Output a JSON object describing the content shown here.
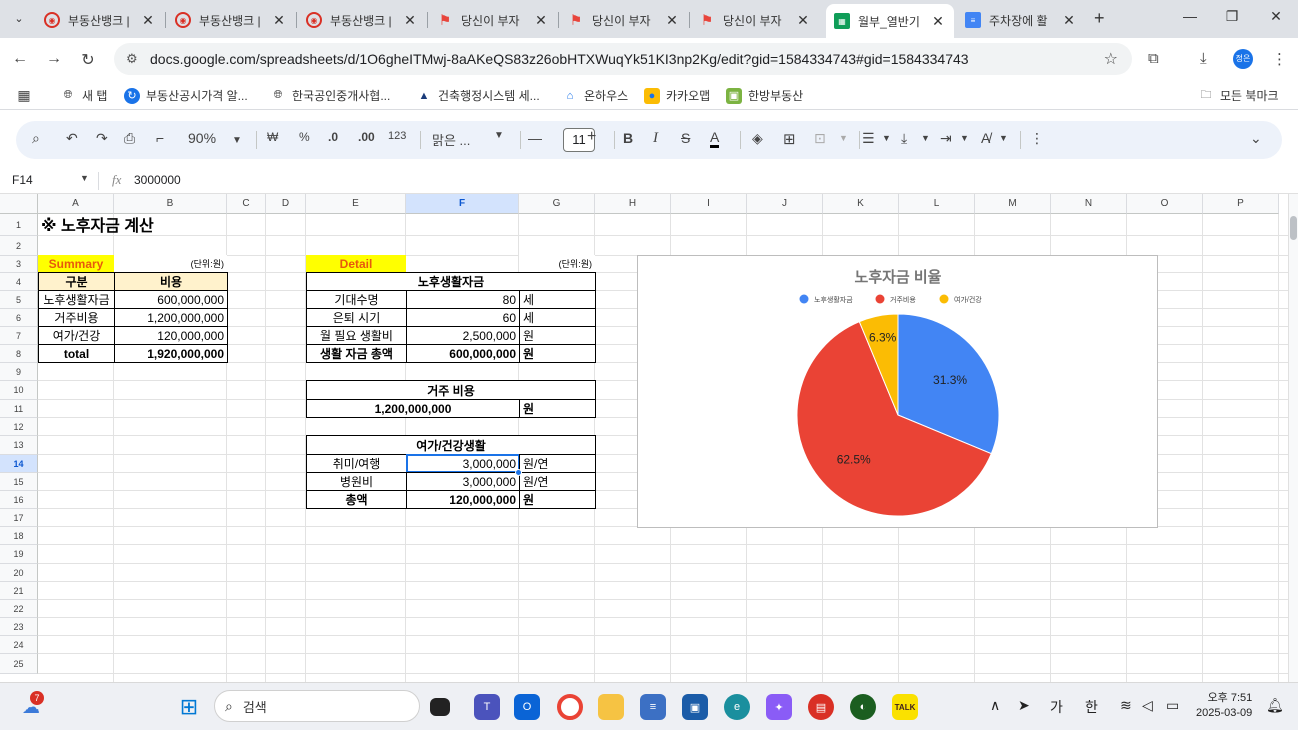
{
  "browser": {
    "tabs": [
      {
        "title": "부동산뱅크 |",
        "icon": "budongsanbank-icon",
        "color": "#d93025"
      },
      {
        "title": "부동산뱅크 |",
        "icon": "budongsanbank-icon",
        "color": "#d93025"
      },
      {
        "title": "부동산뱅크 |",
        "icon": "budongsanbank-icon",
        "color": "#d93025"
      },
      {
        "title": "당신이 부자",
        "icon": "flag-icon",
        "color": "#e8453c"
      },
      {
        "title": "당신이 부자",
        "icon": "flag-icon",
        "color": "#e8453c"
      },
      {
        "title": "당신이 부자",
        "icon": "flag-icon",
        "color": "#e8453c"
      },
      {
        "title": "월부_열반기",
        "icon": "sheets-icon",
        "color": "#0f9d58"
      },
      {
        "title": "주차장에 활",
        "icon": "forms-icon",
        "color": "#4285f4"
      }
    ],
    "active_tab": 6,
    "url": "docs.google.com/spreadsheets/d/1O6gheITMwj-8aAKeQS83z26obHTXWuqYk51KI3np2Kg/edit?gid=1584334743#gid=1584334743",
    "profile": "정은",
    "bookmarks": [
      "새 탭",
      "부동산공시가격 알...",
      "한국공인중개사협...",
      "건축행정시스템 세...",
      "온하우스",
      "카카오맵",
      "한방부동산"
    ],
    "all_bookmarks": "모든 북마크"
  },
  "toolbar": {
    "zoom": "90%",
    "currency": "₩",
    "percent": "%",
    "dec_less": ".0",
    "dec_more": ".00",
    "number_format": "123",
    "font": "맑은 ...",
    "font_size": "11"
  },
  "formula_bar": {
    "cell_ref": "F14",
    "fx": "fx",
    "value": "3000000"
  },
  "grid": {
    "columns": [
      "A",
      "B",
      "C",
      "D",
      "E",
      "F",
      "G",
      "H",
      "I",
      "J",
      "K",
      "L",
      "M",
      "N",
      "O",
      "P"
    ],
    "rows": [
      "1",
      "2",
      "3",
      "4",
      "5",
      "6",
      "7",
      "8",
      "9",
      "10",
      "11",
      "12",
      "13",
      "14",
      "15",
      "16",
      "17",
      "18",
      "19",
      "20",
      "21",
      "22",
      "23",
      "24",
      "25"
    ],
    "selected_col": "F",
    "selected_row": "14"
  },
  "sheet": {
    "title": "※ 노후자금 계산",
    "summary_label": "Summary",
    "unit_left": "(단위:원)",
    "summary_headers": [
      "구분",
      "비용"
    ],
    "summary_rows": [
      [
        "노후생활자금",
        "600,000,000"
      ],
      [
        "거주비용",
        "1,200,000,000"
      ],
      [
        "여가/건강",
        "120,000,000"
      ]
    ],
    "summary_total": [
      "total",
      "1,920,000,000"
    ],
    "detail_label": "Detail",
    "unit_right": "(단위:원)",
    "living_header": "노후생활자금",
    "living_rows": [
      [
        "기대수명",
        "80",
        "세"
      ],
      [
        "은퇴 시기",
        "60",
        "세"
      ],
      [
        "월 필요 생활비",
        "2,500,000",
        "원"
      ],
      [
        "생활 자금 총액",
        "600,000,000",
        "원"
      ]
    ],
    "housing_header": "거주 비용",
    "housing_row": [
      "1,200,000,000",
      "원"
    ],
    "leisure_header": "여가/건강생활",
    "leisure_rows": [
      [
        "취미/여행",
        "3,000,000",
        "원/연"
      ],
      [
        "병원비",
        "3,000,000",
        "원/연"
      ],
      [
        "총액",
        "120,000,000",
        "원"
      ]
    ]
  },
  "chart_data": {
    "type": "pie",
    "title": "노후자금 비율",
    "categories": [
      "노후생활자금",
      "거주비용",
      "여가/건강"
    ],
    "values": [
      600000000,
      1200000000,
      120000000
    ],
    "percent_labels": [
      "31.3%",
      "62.5%",
      "6.3%"
    ],
    "colors": [
      "#4285f4",
      "#ea4335",
      "#fbbc04"
    ],
    "legend": "top"
  },
  "taskbar": {
    "search": "검색",
    "notification_count": "7",
    "ime_1": "가",
    "ime_2": "한",
    "time": "오후 7:51",
    "date": "2025-03-09"
  }
}
